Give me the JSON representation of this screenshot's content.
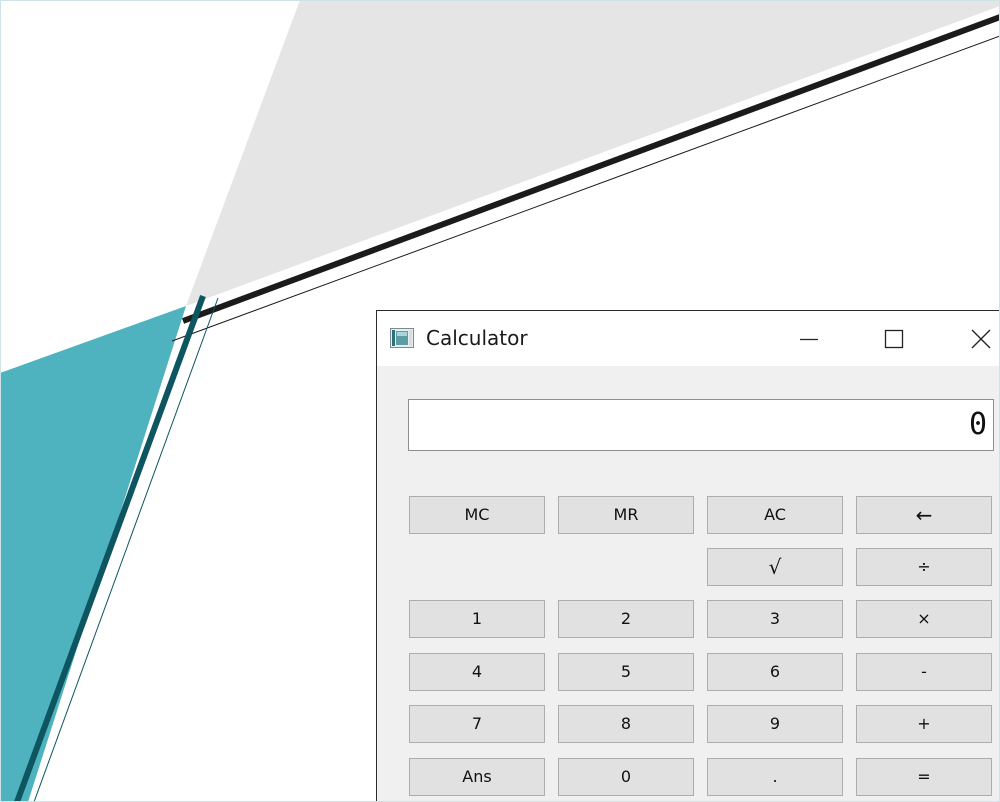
{
  "window": {
    "title": "Calculator",
    "icon": "calculator-app-icon",
    "controls": {
      "minimize": "minimize-icon",
      "maximize": "maximize-icon",
      "close": "close-icon"
    }
  },
  "display": {
    "value": "0"
  },
  "keys": {
    "mc": "MC",
    "mr": "MR",
    "ac": "AC",
    "backspace": "←",
    "sqrt": "√",
    "divide": "÷",
    "one": "1",
    "two": "2",
    "three": "3",
    "multiply": "×",
    "four": "4",
    "five": "5",
    "six": "6",
    "minus": "-",
    "seven": "7",
    "eight": "8",
    "nine": "9",
    "plus": "+",
    "ans": "Ans",
    "zero": "0",
    "point": ".",
    "equals": "="
  },
  "colors": {
    "wallpaper_gray": "#e5e5e5",
    "wallpaper_teal": "#4eb3bf",
    "wallpaper_dark_teal": "#0d5560",
    "wallpaper_black_line": "#1b1b1b",
    "window_bg": "#f0f0f0",
    "key_bg": "#e1e1e1"
  }
}
